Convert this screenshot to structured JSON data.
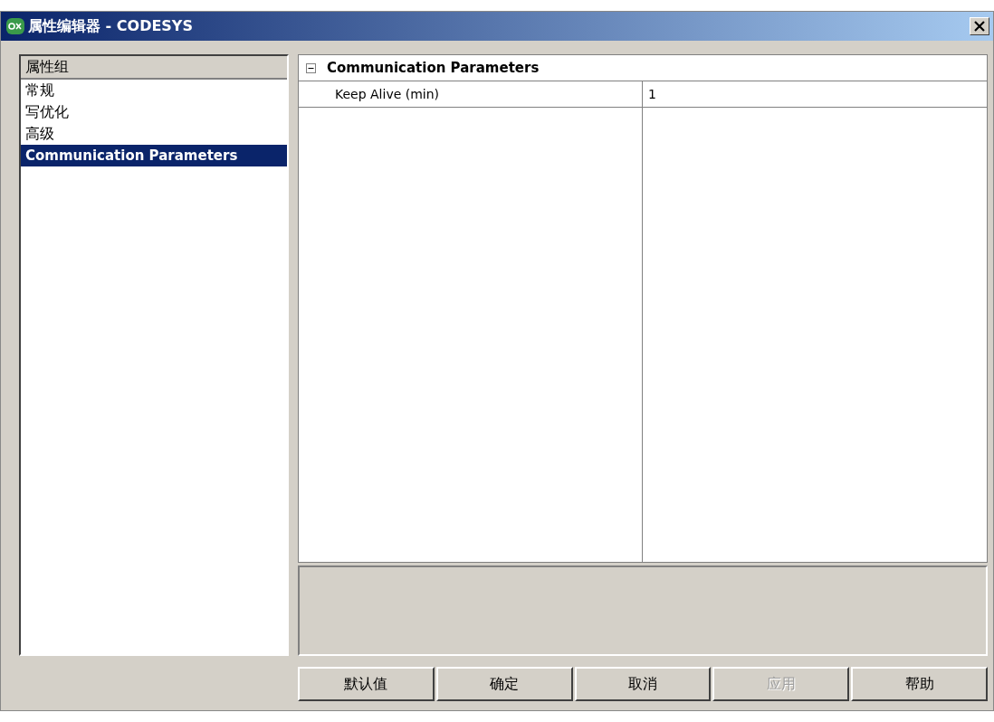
{
  "window": {
    "title": "属性编辑器 - CODESYS"
  },
  "groups": {
    "header": "属性组",
    "items": [
      {
        "label": "常规",
        "selected": false
      },
      {
        "label": "写优化",
        "selected": false
      },
      {
        "label": "高级",
        "selected": false
      },
      {
        "label": "Communication Parameters",
        "selected": true
      }
    ]
  },
  "property_grid": {
    "category": {
      "label": "Communication Parameters",
      "expanded": true
    },
    "rows": [
      {
        "name": "Keep Alive (min)",
        "value": "1"
      }
    ]
  },
  "buttons": [
    {
      "label": "默认值",
      "disabled": false
    },
    {
      "label": "确定",
      "disabled": false
    },
    {
      "label": "取消",
      "disabled": false
    },
    {
      "label": "应用",
      "disabled": true
    },
    {
      "label": "帮助",
      "disabled": false
    }
  ]
}
